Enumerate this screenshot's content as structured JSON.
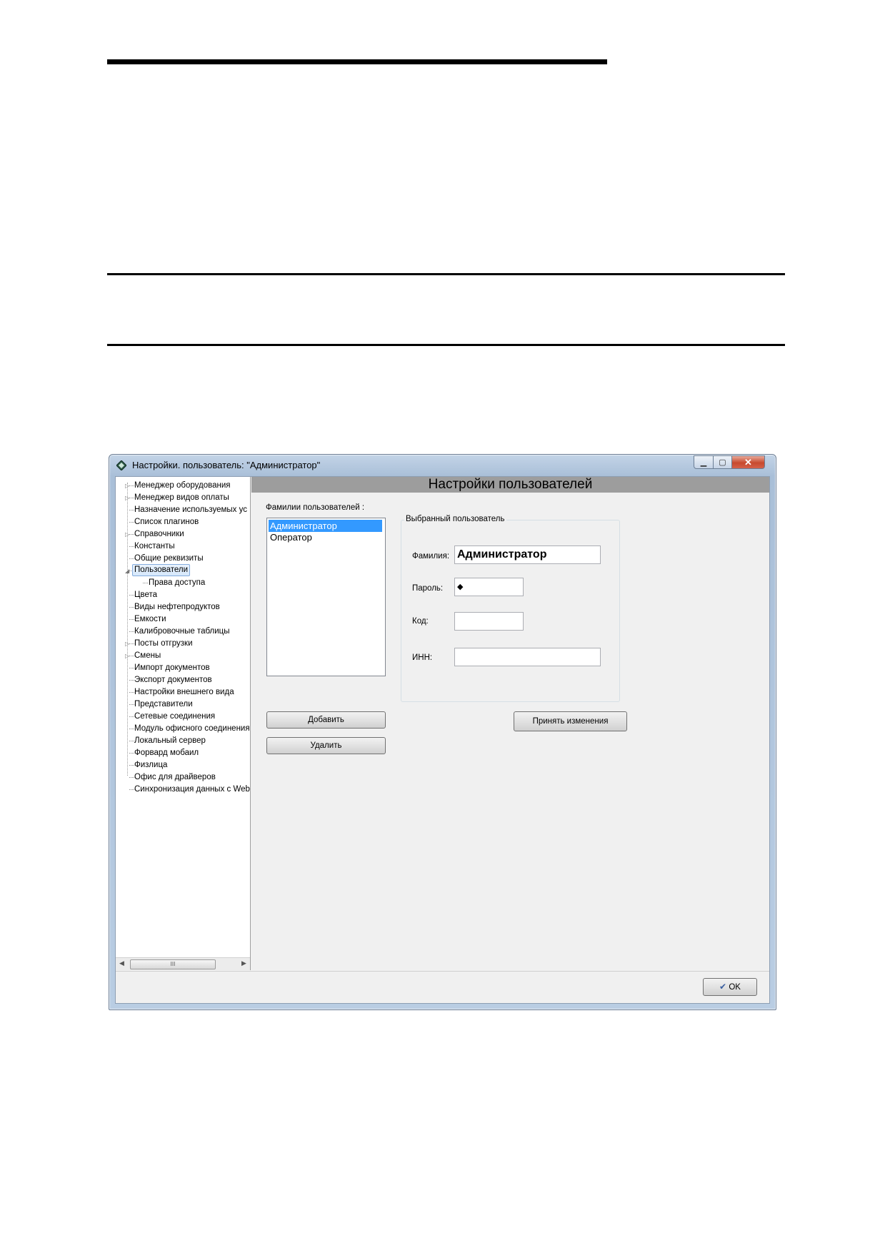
{
  "window": {
    "title": "Настройки. пользователь: \"Администратор\""
  },
  "tree": {
    "items": [
      {
        "label": "Менеджер оборудования",
        "expander": "▷"
      },
      {
        "label": "Менеджер видов оплаты",
        "expander": "▷"
      },
      {
        "label": "Назначение используемых ус",
        "expander": ""
      },
      {
        "label": "Список плагинов",
        "expander": ""
      },
      {
        "label": "Справочники",
        "expander": "▷"
      },
      {
        "label": "Константы",
        "expander": ""
      },
      {
        "label": "Общие реквизиты",
        "expander": ""
      },
      {
        "label": "Пользователи",
        "expander": "◢",
        "selected": true
      },
      {
        "label": "Права доступа",
        "expander": "",
        "child": true
      },
      {
        "label": "Цвета",
        "expander": ""
      },
      {
        "label": "Виды нефтепродуктов",
        "expander": ""
      },
      {
        "label": "Емкости",
        "expander": ""
      },
      {
        "label": "Калибровочные таблицы",
        "expander": ""
      },
      {
        "label": "Посты отгрузки",
        "expander": "▷"
      },
      {
        "label": "Смены",
        "expander": "▷"
      },
      {
        "label": "Импорт документов",
        "expander": ""
      },
      {
        "label": "Экспорт документов",
        "expander": ""
      },
      {
        "label": "Настройки внешнего вида",
        "expander": ""
      },
      {
        "label": "Представители",
        "expander": ""
      },
      {
        "label": "Сетевые соединения",
        "expander": ""
      },
      {
        "label": "Модуль офисного соединения",
        "expander": ""
      },
      {
        "label": "Локальный сервер",
        "expander": ""
      },
      {
        "label": "Форвард мобаил",
        "expander": ""
      },
      {
        "label": "Физлица",
        "expander": ""
      },
      {
        "label": "Офис для драйверов",
        "expander": ""
      },
      {
        "label": "Синхронизация данных с Web",
        "expander": ""
      }
    ],
    "scroll_thumb": "III"
  },
  "main": {
    "header": "Настройки пользователей",
    "users_label": "Фамилии пользователей :",
    "users": [
      "Администратор",
      "Оператор"
    ],
    "selected_user_group": "Выбранный пользователь",
    "fields": {
      "surname_label": "Фамилия:",
      "surname_value": "Администратор",
      "password_label": "Пароль:",
      "password_value": "◆",
      "code_label": "Код:",
      "code_value": "",
      "inn_label": "ИНН:",
      "inn_value": ""
    },
    "buttons": {
      "add": "Добавить",
      "delete": "Удалить",
      "apply": "Принять изменения",
      "ok": "OK"
    }
  }
}
